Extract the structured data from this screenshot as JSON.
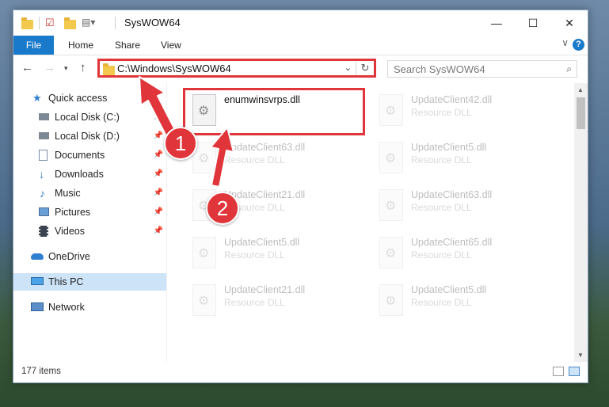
{
  "window": {
    "title": "SysWOW64",
    "controls": {
      "minimize": "—",
      "maximize": "☐",
      "close": "✕"
    }
  },
  "ribbon": {
    "tabs": [
      "File",
      "Home",
      "Share",
      "View"
    ],
    "help": "?",
    "expand": "∨"
  },
  "nav": {
    "address": "C:\\Windows\\SysWOW64",
    "search_placeholder": "Search SysWOW64"
  },
  "sidebar": {
    "items": [
      {
        "label": "Quick access",
        "icon": "star-icon"
      },
      {
        "label": "Local Disk (C:)",
        "icon": "drive-icon",
        "pinned": true
      },
      {
        "label": "Local Disk (D:)",
        "icon": "drive-icon",
        "pinned": true
      },
      {
        "label": "Documents",
        "icon": "documents-icon",
        "pinned": true
      },
      {
        "label": "Downloads",
        "icon": "downloads-icon",
        "pinned": true
      },
      {
        "label": "Music",
        "icon": "music-icon",
        "pinned": true
      },
      {
        "label": "Pictures",
        "icon": "pictures-icon",
        "pinned": true
      },
      {
        "label": "Videos",
        "icon": "videos-icon",
        "pinned": true
      },
      {
        "label": "OneDrive",
        "icon": "onedrive-icon"
      },
      {
        "label": "This PC",
        "icon": "computer-icon",
        "selected": true
      },
      {
        "label": "Network",
        "icon": "network-icon"
      }
    ]
  },
  "files": {
    "highlighted": {
      "name": "enumwinsvrps.dll"
    },
    "items": [
      {
        "name": "UpdateClient42.dll",
        "type": "Resource DLL"
      },
      {
        "name": "UpdateClient63.dll",
        "type": "Resource DLL"
      },
      {
        "name": "UpdateClient5.dll",
        "type": "Resource DLL"
      },
      {
        "name": "UpdateClient21.dll",
        "type": "Resource DLL"
      },
      {
        "name": "UpdateClient63.dll",
        "type": "Resource DLL"
      },
      {
        "name": "UpdateClient5.dll",
        "type": "Resource DLL"
      },
      {
        "name": "UpdateClient65.dll",
        "type": "Resource DLL"
      },
      {
        "name": "UpdateClient21.dll",
        "type": "Resource DLL"
      },
      {
        "name": "UpdateClient5.dll",
        "type": "Resource DLL"
      }
    ]
  },
  "status": {
    "count": "177 items"
  },
  "callouts": {
    "step1": "1",
    "step2": "2",
    "color": "#e0353a"
  }
}
